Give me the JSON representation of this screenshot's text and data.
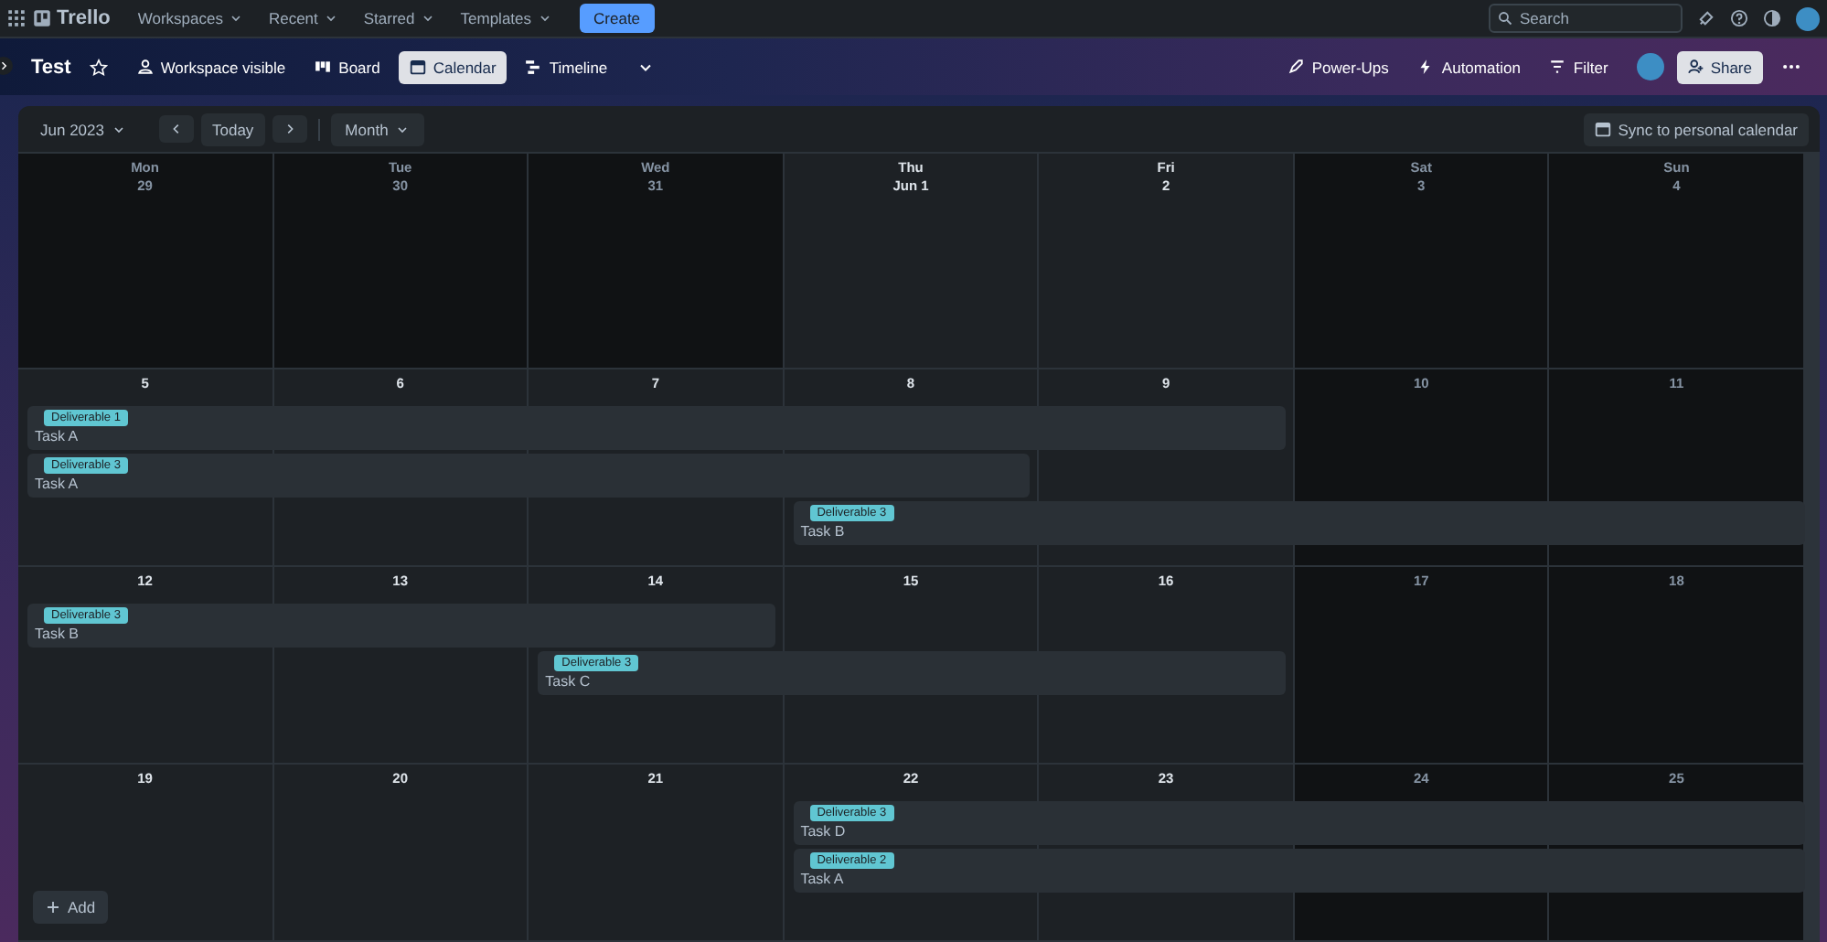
{
  "topbar": {
    "app_name": "Trello",
    "menus": [
      "Workspaces",
      "Recent",
      "Starred",
      "Templates"
    ],
    "create_label": "Create",
    "search": {
      "placeholder": "Search"
    }
  },
  "board": {
    "title": "Test",
    "starred": false,
    "visibility": "Workspace visible",
    "views": [
      {
        "label": "Board",
        "selected": false
      },
      {
        "label": "Calendar",
        "selected": true
      },
      {
        "label": "Timeline",
        "selected": false
      }
    ],
    "actions": [
      "Power-Ups",
      "Automation",
      "Filter"
    ],
    "share_label": "Share"
  },
  "calendar": {
    "month": "Jun 2023",
    "today_label": "Today",
    "range": "Month",
    "sync_label": "Sync to personal calendar",
    "weekdays": [
      "Mon",
      "Tue",
      "Wed",
      "Thu",
      "Fri",
      "Sat",
      "Sun"
    ],
    "weeks": [
      {
        "days": [
          {
            "label": "29",
            "dimmed": true
          },
          {
            "label": "30",
            "dimmed": true
          },
          {
            "label": "31",
            "dimmed": true
          },
          {
            "label": "Jun 1",
            "dimmed": false
          },
          {
            "label": "2",
            "dimmed": false
          },
          {
            "label": "3",
            "dimmed": true
          },
          {
            "label": "4",
            "dimmed": true
          }
        ]
      },
      {
        "days": [
          {
            "label": "5",
            "dimmed": false,
            "events": [
              {
                "kind": "start",
                "tag": "Deliverable 1",
                "title": "Task A"
              },
              {
                "kind": "start",
                "tag": "Deliverable 3",
                "title": "Task A"
              }
            ]
          },
          {
            "label": "6",
            "dimmed": false,
            "events": [
              {
                "kind": "continued"
              },
              {
                "kind": "continued"
              }
            ]
          },
          {
            "label": "7",
            "dimmed": false,
            "events": [
              {
                "kind": "continued"
              },
              {
                "kind": "continued"
              }
            ]
          },
          {
            "label": "8",
            "dimmed": false,
            "events": [
              {
                "kind": "continued"
              },
              {
                "kind": "continued"
              },
              {
                "kind": "start",
                "tag": "Deliverable 3",
                "title": "Task B"
              }
            ]
          },
          {
            "label": "9",
            "dimmed": false,
            "events": [
              {
                "kind": "continued"
              },
              {
                "kind": "blank"
              },
              {
                "kind": "continued"
              }
            ]
          },
          {
            "label": "10",
            "dimmed": true,
            "events": [
              {
                "kind": "blank"
              },
              {
                "kind": "blank"
              },
              {
                "kind": "continued"
              }
            ]
          },
          {
            "label": "11",
            "dimmed": true,
            "events": [
              {
                "kind": "blank"
              },
              {
                "kind": "blank"
              },
              {
                "kind": "continued"
              }
            ]
          }
        ]
      },
      {
        "days": [
          {
            "label": "12",
            "dimmed": false,
            "events": [
              {
                "kind": "start",
                "tag": "Deliverable 3",
                "title": "Task B"
              }
            ]
          },
          {
            "label": "13",
            "dimmed": false,
            "events": [
              {
                "kind": "continued"
              }
            ]
          },
          {
            "label": "14",
            "dimmed": false,
            "events": [
              {
                "kind": "continued"
              },
              {
                "kind": "start",
                "tag": "Deliverable 3",
                "title": "Task C"
              }
            ]
          },
          {
            "label": "15",
            "dimmed": false,
            "events": [
              {
                "kind": "blank"
              },
              {
                "kind": "continued"
              }
            ]
          },
          {
            "label": "16",
            "dimmed": false,
            "events": [
              {
                "kind": "blank"
              },
              {
                "kind": "continued"
              }
            ]
          },
          {
            "label": "17",
            "dimmed": true
          },
          {
            "label": "18",
            "dimmed": true
          }
        ]
      },
      {
        "days": [
          {
            "label": "19",
            "dimmed": false
          },
          {
            "label": "20",
            "dimmed": false
          },
          {
            "label": "21",
            "dimmed": false
          },
          {
            "label": "22",
            "dimmed": false,
            "events": [
              {
                "kind": "start",
                "tag": "Deliverable 3",
                "title": "Task D"
              },
              {
                "kind": "start",
                "tag": "Deliverable 2",
                "title": "Task A"
              }
            ]
          },
          {
            "label": "23",
            "dimmed": false,
            "events": [
              {
                "kind": "continued"
              },
              {
                "kind": "continued"
              }
            ]
          },
          {
            "label": "24",
            "dimmed": true,
            "events": [
              {
                "kind": "continued"
              },
              {
                "kind": "continued"
              }
            ]
          },
          {
            "label": "25",
            "dimmed": true,
            "events": [
              {
                "kind": "continued"
              },
              {
                "kind": "continued"
              }
            ]
          }
        ]
      }
    ],
    "add_label": "Add"
  }
}
